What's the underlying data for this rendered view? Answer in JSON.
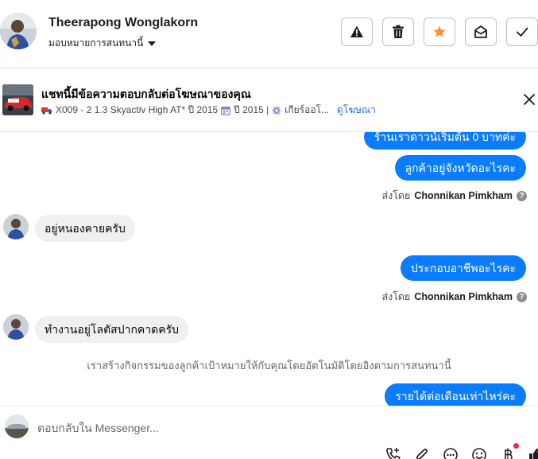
{
  "header": {
    "contact_name": "Theerapong Wonglakorn",
    "assign_label": "มอบหมายการสนทนานี้",
    "actions": [
      {
        "name": "report-button",
        "icon": "warning-icon",
        "color": "#1c1e21"
      },
      {
        "name": "delete-button",
        "icon": "trash-icon",
        "color": "#1c1e21"
      },
      {
        "name": "star-button",
        "icon": "star-icon",
        "color": "#f7923a"
      },
      {
        "name": "mark-unread-button",
        "icon": "envelope-open-icon",
        "color": "#1c1e21"
      },
      {
        "name": "done-button",
        "icon": "check-icon",
        "color": "#1c1e21"
      }
    ]
  },
  "ad_banner": {
    "title": "แชทนี้มีข้อความตอบกลับต่อโฆษณาของคุณ",
    "model": "X009 - 2 1.3 Skyactiv High AT* ปี 2015",
    "year": "ปี 2015 |",
    "gear": "เกียร์ออโ...",
    "link": "ดูโฆษณา"
  },
  "messages": {
    "out_1": "ร้านเราดาวน์เริ่มต้น 0 บาทค่ะ",
    "out_2": "ลูกค้าอยู่จังหวัดอะไรคะ",
    "sent_by_prefix": "ส่งโดย",
    "agent_name": "Chonnikan Pimkham",
    "in_1": "อยู่หนองคายครับ",
    "out_3": "ประกอบอาชีพอะไรคะ",
    "in_2": "ทำงานอยู่โลตัสปากคาดครับ",
    "notice": "เราสร้างกิจกรรมของลูกค้าเป้าหมายให้กับคุณโดยอัตโนมัติโดยอิงตามการสนทนานี้",
    "out_4": "รายได้ต่อเดือนเท่าไหร่คะ"
  },
  "composer": {
    "placeholder": "ตอบกลับใน Messenger..."
  },
  "colors": {
    "accent": "#0a7cff",
    "link": "#216fdb",
    "star": "#f7923a",
    "badge": "#f02849"
  }
}
